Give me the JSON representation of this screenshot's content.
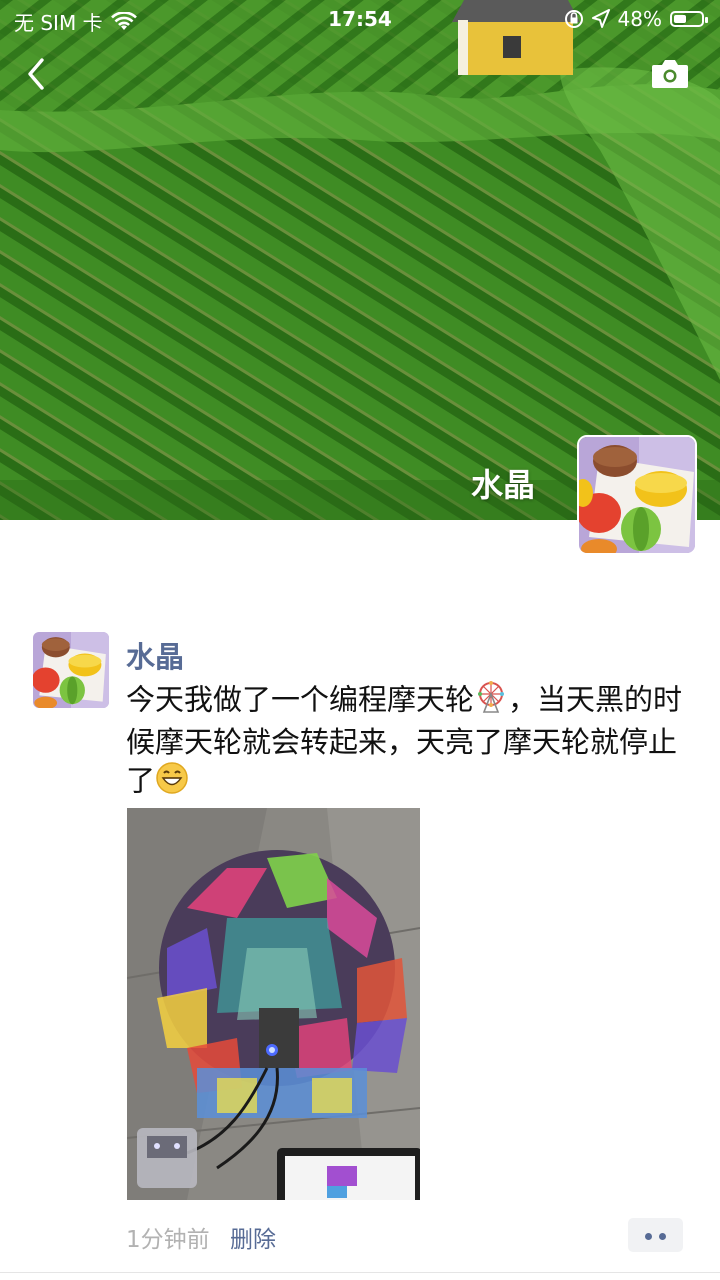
{
  "status_bar": {
    "carrier": "无 SIM 卡",
    "time": "17:54",
    "battery": "48%",
    "battery_level": 0.48
  },
  "nav": {
    "back_icon": "chevron-left-icon",
    "camera_icon": "camera-icon"
  },
  "profile": {
    "name": "水晶",
    "avatar": "macaron-avatar"
  },
  "post": {
    "author": "水晶",
    "text_part1": "今天我做了一个编程摩天轮",
    "text_part2": "，当天黑的时候摩天轮就会转起来，天亮了摩天轮就停止了",
    "emoji1": "ferris-wheel-emoji",
    "emoji2": "grinning-face-emoji",
    "image": "magnetic-tiles-ferris-wheel-photo",
    "time": "1分钟前",
    "delete": "删除",
    "more_icon": "more-dots-icon"
  },
  "colors": {
    "link": "#576b95",
    "meta": "#b2b2b2",
    "text": "#111111"
  }
}
